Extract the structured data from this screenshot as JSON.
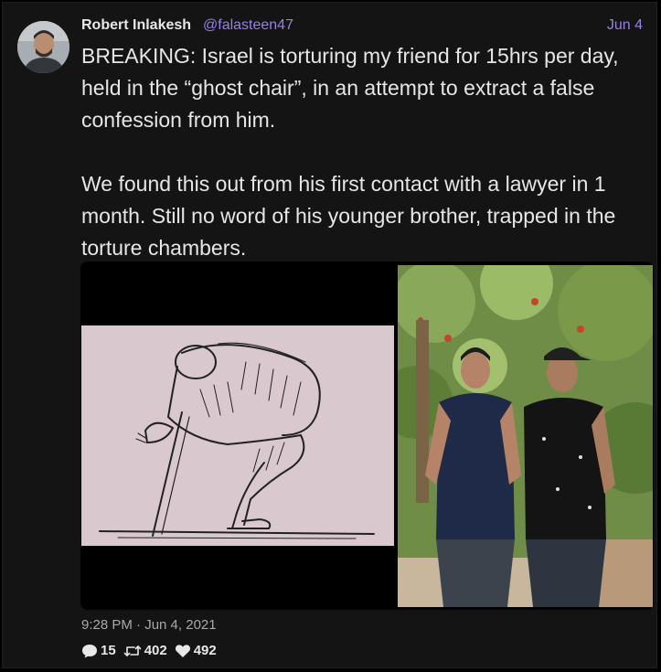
{
  "tweet": {
    "author_name": "Robert Inlakesh",
    "author_handle": "@falasteen47",
    "date": "Jun 4",
    "text": "BREAKING: Israel is torturing my friend for 15hrs per day, held in the “ghost chair”, in an attempt to extract a false confession from him.\n\nWe found this out from his first contact with a lawyer in 1 month. Still no word of his younger brother, trapped in the torture chambers.",
    "timestamp": "9:28 PM · Jun 4, 2021",
    "replies": "15",
    "retweets": "402",
    "likes": "492"
  },
  "icons": {
    "reply": "speech-bubble-icon",
    "retweet": "retweet-icon",
    "like": "heart-icon"
  },
  "colors": {
    "background": "#141414",
    "accent": "#9b7fe6",
    "text": "#e6e6e6",
    "muted": "#a9a9a9"
  }
}
